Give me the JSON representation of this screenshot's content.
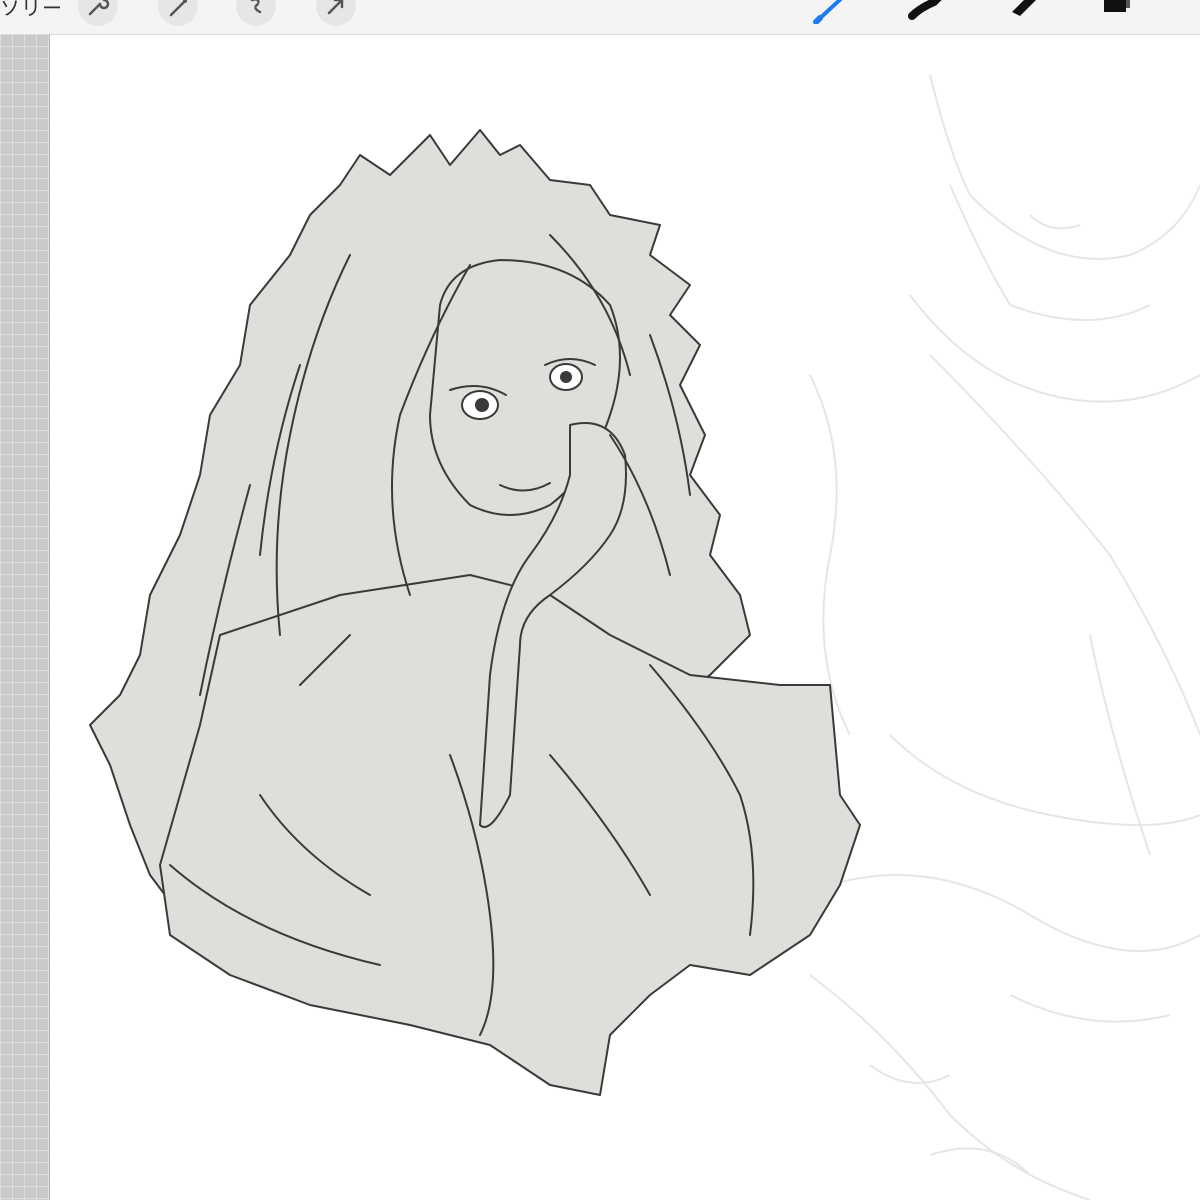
{
  "toolbar": {
    "gallery_label": "ソリー",
    "left_tools": [
      {
        "icon": "wrench-icon"
      },
      {
        "icon": "magic-wand-icon"
      },
      {
        "icon": "selection-icon"
      },
      {
        "icon": "transform-arrow-icon"
      }
    ],
    "right_tools": [
      {
        "icon": "brush-icon",
        "active": true
      },
      {
        "icon": "smudge-icon"
      },
      {
        "icon": "eraser-icon"
      },
      {
        "icon": "layers-icon"
      }
    ],
    "active_color": "#1e7bf0"
  },
  "canvas": {
    "artwork": "line-art-character-with-long-hair",
    "fill_color": "#dededa",
    "line_color": "#3a3a3a",
    "sketch_color": "#e6e6e6"
  }
}
